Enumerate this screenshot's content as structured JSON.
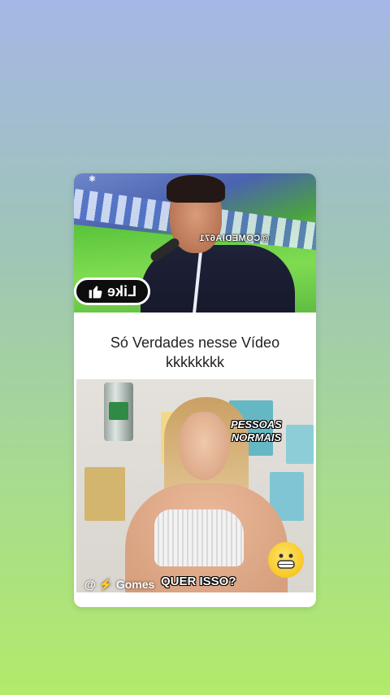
{
  "top_video": {
    "watermark": "@COMEDIA671",
    "like_badge": "Like",
    "thumb_icon": "thumbs-up-icon"
  },
  "caption": {
    "line1": "Só Verdades nesse Vídeo",
    "line2": "kkkkkkkk"
  },
  "bottom_video": {
    "sticker_line1": "PESSOAS",
    "sticker_line2": "NORMAIS",
    "handle": "@ ⚡ Gomes",
    "question": "QUER ISSO?",
    "emoji": "grinning-face-icon"
  },
  "colors": {
    "card_bg": "#ffffff",
    "badge_bg": "#0d0d0d",
    "emoji_yellow": "#f7c51c"
  }
}
